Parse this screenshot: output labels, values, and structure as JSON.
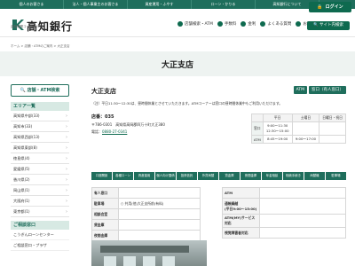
{
  "topnav": {
    "items": [
      "個人のお客さま",
      "法人・個人事業主のお客さま",
      "資産運用・ふやす",
      "ローン・かりる",
      "高知銀行について",
      "採用情報"
    ],
    "login_label": "ログイン"
  },
  "header": {
    "bank_name": "高知銀行",
    "bank_code": "金融機関コード：0578",
    "links": [
      "店舗検索・ATM",
      "手数料",
      "金利",
      "よくある質問",
      "お問い合わせ"
    ],
    "site_search_label": "サイト内検索"
  },
  "breadcrumb": "ホーム > 店舗・ATMのご案内 > 大正支店",
  "page_title": "大正支店",
  "sidebar": {
    "search_button_label": "店舗・ATM検索",
    "area_heading": "エリア一覧",
    "areas": [
      "高知県中部(33)",
      "高知市(33)",
      "高知県西部(13)",
      "高知県東部(8)",
      "徳島県(4)",
      "愛媛県(5)",
      "香川県(2)",
      "岡山県(1)",
      "大阪府(1)",
      "東京都(1)"
    ],
    "consult_heading": "ご相談窓口",
    "consult_links": [
      "こうぎんローンセンター",
      "ご相談窓口・プラザ"
    ]
  },
  "branch": {
    "name": "大正支店",
    "tags": [
      "ATM",
      "窓口（有人窓口）"
    ],
    "notice": "（注）平日11:30～12:30は、昼時間休業とさせていただきます。ATMコーナーは窓口の昼時間休業中もご利用いただけます。",
    "code_label": "店番：035",
    "address": "〒786-0301　高知県高岡郡四万十町大正380",
    "tel_label": "電話：",
    "tel_number": "0880-27-0341"
  },
  "hours": {
    "col_weekday": "平日",
    "col_saturday": "土曜日",
    "col_holiday": "日曜日・祝日",
    "row_window": "窓口",
    "row_atm": "ATM",
    "window_weekday": "9:00～11:30\n12:30～15:00",
    "window_saturday": "",
    "window_holiday": "",
    "atm_weekday": "8:45～19:00",
    "atm_saturday": "9:00～17:00",
    "atm_holiday": ""
  },
  "services": [
    "口座開設",
    "各種ローン",
    "資産運用",
    "個人向け国債",
    "投資信託",
    "外貨両替",
    "貸金庫",
    "夜間金庫",
    "年金相談",
    "相続手続き",
    "両替機",
    "駐車場"
  ],
  "facility_left": {
    "rows": [
      {
        "label": "有人窓口",
        "value": ""
      },
      {
        "label": "駐車場",
        "value": "○ 共用(他)大正支所前(有料)"
      },
      {
        "label": "相談会室",
        "value": ""
      },
      {
        "label": "貸金庫",
        "value": ""
      },
      {
        "label": "夜間金庫",
        "value": ""
      }
    ]
  },
  "facility_right": {
    "rows": [
      {
        "label": "ATM",
        "value": ""
      },
      {
        "label": "通帳繰越\n(平日9:00～15:00)",
        "value": ""
      },
      {
        "label": "ATM(MY)サービス対応",
        "value": ""
      },
      {
        "label": "視覚障害者対応",
        "value": ""
      }
    ]
  },
  "colors": {
    "brand": "#1f6e5c",
    "brand_dark": "#0e6a4f",
    "band": "#eef3f1"
  }
}
